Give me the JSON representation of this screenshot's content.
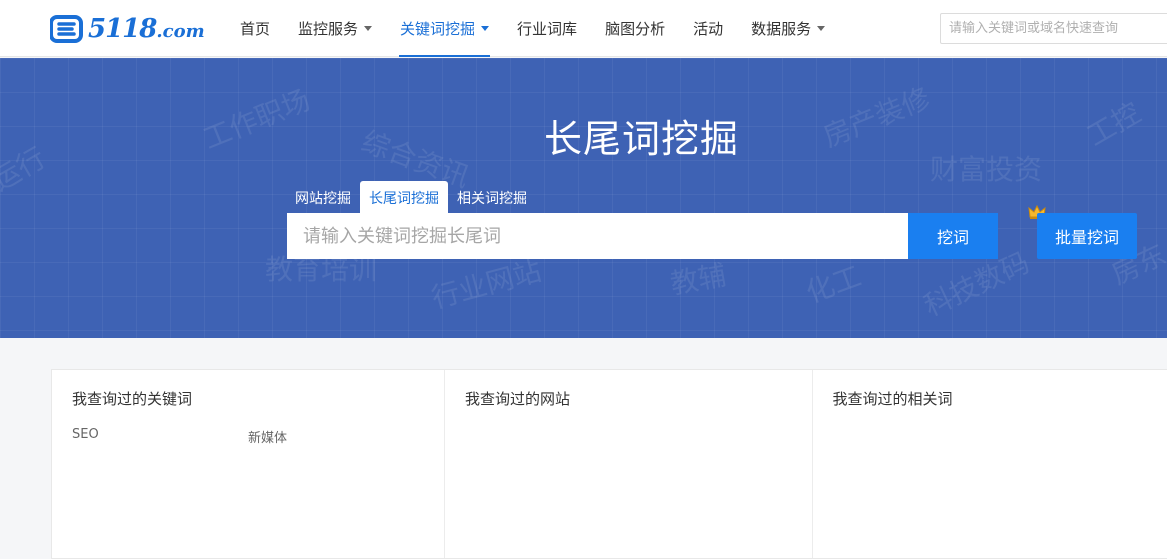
{
  "header": {
    "logo_number": "5118",
    "logo_suffix": ".com",
    "nav": [
      {
        "label": "首页",
        "has_caret": false,
        "active": false
      },
      {
        "label": "监控服务",
        "has_caret": true,
        "active": false
      },
      {
        "label": "关键词挖掘",
        "has_caret": true,
        "active": true
      },
      {
        "label": "行业词库",
        "has_caret": false,
        "active": false
      },
      {
        "label": "脑图分析",
        "has_caret": false,
        "active": false
      },
      {
        "label": "活动",
        "has_caret": false,
        "active": false
      },
      {
        "label": "数据服务",
        "has_caret": true,
        "active": false
      }
    ],
    "quick_search_placeholder": "请输入关键词或域名快速查询"
  },
  "banner": {
    "title": "长尾词挖掘",
    "watermarks": [
      "工作职场",
      "综合资讯",
      "房产装修",
      "财富投资",
      "教育培训",
      "行业网站",
      "教辅",
      "化工",
      "科技数码",
      "运行",
      "工控",
      "房东"
    ],
    "tabs": [
      {
        "label": "网站挖掘",
        "active": false
      },
      {
        "label": "长尾词挖掘",
        "active": true
      },
      {
        "label": "相关词挖掘",
        "active": false
      }
    ],
    "search_placeholder": "请输入关键词挖掘长尾词",
    "search_button": "挖词",
    "batch_button": "批量挖词"
  },
  "history": {
    "keywords_title": "我查询过的关键词",
    "keywords": [
      "SEO",
      "新媒体"
    ],
    "sites_title": "我查询过的网站",
    "related_title": "我查询过的相关词"
  },
  "colors": {
    "brand": "#1a6fd6",
    "banner_bg": "#3e62b4",
    "button": "#1a7ff0"
  }
}
